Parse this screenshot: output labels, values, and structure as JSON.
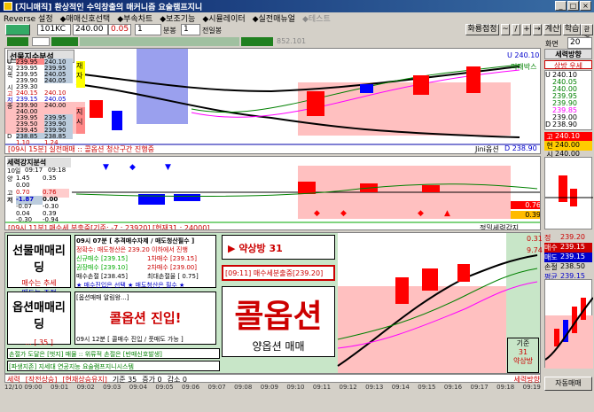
{
  "window": {
    "title": "[지니매직] 환상적인 수익창출의 매커니즘 요술램프지니"
  },
  "menu": [
    "Reverse 설정",
    "◆매매신호선택",
    "◆부속차트",
    "◆보조기능",
    "◆시뮬레이터",
    "◆실전매뉴얼",
    "◆테스트"
  ],
  "toolbar": {
    "code": "101KC",
    "price": "240.00",
    "step": "0.05",
    "qty": "1",
    "bun": "분봉",
    "qty2": "1",
    "prev": "전일봉",
    "rate_btn": "화룡점정",
    "calc_btn": "계산",
    "learn_btn": "학습",
    "env_btn": "환경",
    "screen_label": "화면",
    "screen_val": "20",
    "tab_code": "852.101"
  },
  "top_chart": {
    "header": "선물지수분석",
    "rows": [
      {
        "label": "U",
        "a": "239.95",
        "b": "240.10"
      },
      {
        "label": "직",
        "a": "239.95",
        "b": "239.95"
      },
      {
        "label": "목",
        "a": "239.95",
        "b": "240.05"
      },
      {
        "label": "",
        "a": "239.90",
        "b": "240.05"
      },
      {
        "label": "시",
        "a": "239.30",
        "b": ""
      },
      {
        "label": "고",
        "a": "240.15",
        "b": "240.10"
      },
      {
        "label": "저",
        "a": "239.15",
        "b": "240.05"
      },
      {
        "label": "종",
        "a": "239.90",
        "b": "240.00"
      },
      {
        "label": "",
        "a": "240.00",
        "b": ""
      },
      {
        "label": "",
        "a": "239.95",
        "b": "239.95"
      },
      {
        "label": "",
        "a": "239.50",
        "b": "239.90"
      },
      {
        "label": "",
        "a": "239.45",
        "b": "239.90"
      },
      {
        "label": "D",
        "a": "238.85",
        "b": "238.85"
      },
      {
        "label": "",
        "a": "1.10",
        "b": "1.24"
      }
    ],
    "side_badge": "재\n자",
    "side_badge2": "지\n시",
    "u_label": "U 240.10",
    "trend_label": "미래박스",
    "bottom_left": "[09시 15분] 실전매매 :: 콜옵션 청산구간 진행중",
    "bottom_right1": "Jini옵션",
    "bottom_right2": "D 238.90"
  },
  "right_panel": {
    "title": "세력방향",
    "subtitle": "상방 우세",
    "values": [
      {
        "label": "U",
        "value": "240.10",
        "color": "#000000"
      },
      {
        "label": "",
        "value": "240.05",
        "color": "#008000"
      },
      {
        "label": "",
        "value": "240.00",
        "color": "#008000"
      },
      {
        "label": "",
        "value": "239.95",
        "color": "#008000"
      },
      {
        "label": "",
        "value": "239.90",
        "color": "#008000"
      },
      {
        "label": "",
        "value": "239.85",
        "color": "#ff00ff"
      },
      {
        "label": "",
        "value": "239.00",
        "color": "#000000"
      },
      {
        "label": "D",
        "value": "238.90",
        "color": "#000000"
      }
    ],
    "vert": "미래박스",
    "go": "고",
    "go_val": "240.10",
    "hyun": "현",
    "hyun_val": "240.00",
    "si": "시",
    "si_val": "240.00"
  },
  "mid_chart": {
    "header": "세력강지분석",
    "time_row": {
      "label": "10일",
      "t1": "09:17",
      "t2": "09:18"
    },
    "rows": [
      {
        "label": "양",
        "a": "1.45",
        "b": "0.35"
      },
      {
        "label": "",
        "a": "0.00",
        "b": ""
      },
      {
        "label": "고",
        "a": "0.70",
        "b": "0.76"
      },
      {
        "label": "저",
        "a": "-1.87",
        "b": "0.00"
      },
      {
        "label": "",
        "a": "-0.07",
        "b": "-0.30"
      },
      {
        "label": "",
        "a": "0.04",
        "b": "0.39"
      },
      {
        "label": "",
        "a": "-0.30",
        "b": "-0.94"
      }
    ],
    "val1": "0.76",
    "val2": "0.39",
    "bottom_left": "[09시 11분] 매수세 분출중[기준: -7 : 23920] [현재31 : 24000]",
    "bottom_right": "정밀세력감지"
  },
  "bottom": {
    "futures_title": "선물매매리딩",
    "futures_l1": "매수는 추세",
    "futures_l2": "매도는 조정",
    "option_title": "옵션매매리딩",
    "option_val": "... [ 35 ]",
    "info_header": "09시 07분 [ 추격매수자제 / 매도청산필수 ]",
    "info_l1": "정확수: 매도청산은 239.20 이하에서 진행",
    "info_l2": "신규매수 [239.15]",
    "info_l3": "1차매수 [239.15]",
    "info_l4": "권장매수 [239.10]",
    "info_l5": "2차매수 [239.00]",
    "info_l6": "매수손절 [238.45]",
    "info_l7": "최대손절율 [ 0.75]",
    "info_l8": "★ 매수진입은 선택 ★ 매도청산은 필수 ★",
    "trend_box": "약상방 31",
    "trend_prefix": "▶",
    "status_box": "[09:11] 매수세분출중[239.20]",
    "option_header": "[옵션매매 알림왕...]",
    "option_text": "콜옵션 진입!",
    "option_time": "09시 12분 [ 콜매수 진입  /  풋매도 가능 ]",
    "big_text": "콜옵션",
    "bottom_text": "양옵션 매매",
    "ticker1": "손절가 도달은 [벗지] 매물 :: 위류적 손절은 [반매신호발생]",
    "ticker2": "[파생지존] 지세대 연공지능 요술램프지니시스템",
    "side_label": "기준",
    "side_val": "31",
    "side_sub": "약상방"
  },
  "right_bottom": {
    "values": [
      {
        "label": "정",
        "value": "239.20"
      },
      {
        "label": "매수",
        "value": "239.15"
      },
      {
        "label": "매도",
        "value": "239.15"
      },
      {
        "label": "손절",
        "value": "238.50"
      },
      {
        "label": "평균",
        "value": "239.15"
      }
    ],
    "vals_right": [
      "0.31",
      "9.74"
    ]
  },
  "statusbar": {
    "items": [
      "세력",
      "[작전상승]",
      "[현재상승유지]",
      "기준 35",
      "증가 0",
      "감소 0",
      "세력방향"
    ],
    "btn": "자동매매"
  },
  "timeaxis": [
    "12/10 09:00",
    "09:01",
    "09:02",
    "09:03",
    "09:04",
    "09:05",
    "09:06",
    "09:07",
    "09:08",
    "09:09",
    "09:10",
    "09:11",
    "09:12",
    "09:13",
    "09:14",
    "09:15",
    "09:16",
    "09:17",
    "09:18",
    "09:19"
  ]
}
